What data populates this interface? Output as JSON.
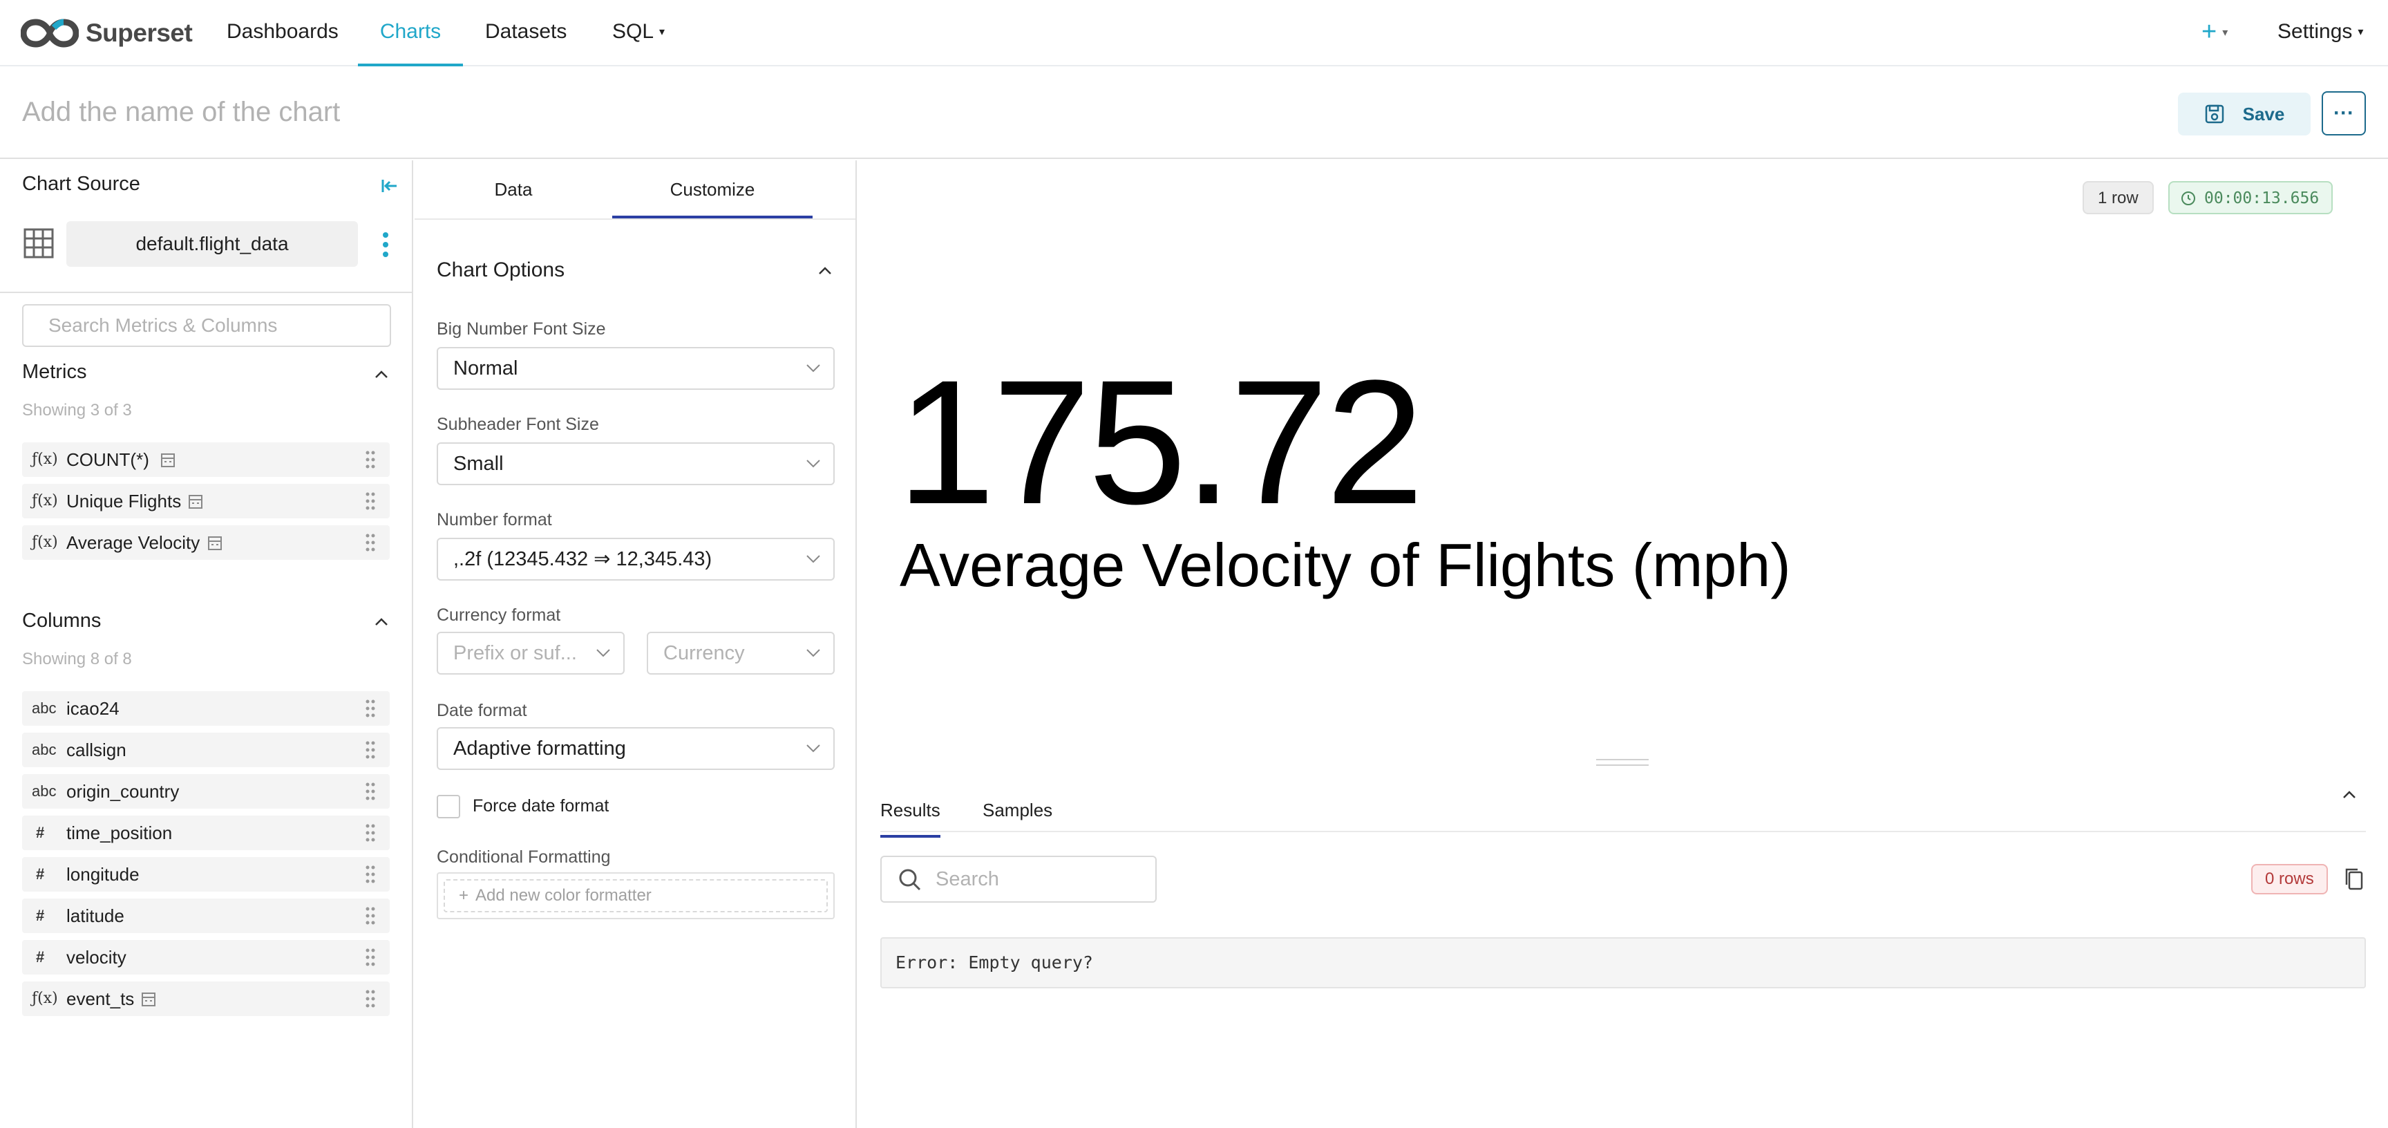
{
  "app": {
    "brand": "Superset"
  },
  "nav": {
    "items": [
      {
        "label": "Dashboards"
      },
      {
        "label": "Charts"
      },
      {
        "label": "Datasets"
      },
      {
        "label": "SQL"
      }
    ],
    "settings_label": "Settings",
    "accent_color": "#20a7c9"
  },
  "header": {
    "title_placeholder": "Add the name of the chart",
    "save_label": "Save"
  },
  "source": {
    "title": "Chart Source",
    "dataset": "default.flight_data",
    "search_placeholder": "Search Metrics & Columns"
  },
  "metrics": {
    "title": "Metrics",
    "showing": "Showing 3 of 3",
    "items": [
      {
        "type": "ƒ(x)",
        "label": "COUNT(*)"
      },
      {
        "type": "ƒ(x)",
        "label": "Unique Flights"
      },
      {
        "type": "ƒ(x)",
        "label": "Average Velocity"
      }
    ]
  },
  "columns": {
    "title": "Columns",
    "showing": "Showing 8 of 8",
    "items": [
      {
        "type": "abc",
        "label": "icao24"
      },
      {
        "type": "abc",
        "label": "callsign"
      },
      {
        "type": "abc",
        "label": "origin_country"
      },
      {
        "type": "#",
        "label": "time_position"
      },
      {
        "type": "#",
        "label": "longitude"
      },
      {
        "type": "#",
        "label": "latitude"
      },
      {
        "type": "#",
        "label": "velocity"
      },
      {
        "type": "ƒ(x)",
        "label": "event_ts"
      }
    ]
  },
  "controls": {
    "tabs": [
      "Data",
      "Customize"
    ],
    "section_title": "Chart Options",
    "big_number_font_size": {
      "label": "Big Number Font Size",
      "value": "Normal"
    },
    "subheader_font_size": {
      "label": "Subheader Font Size",
      "value": "Small"
    },
    "number_format": {
      "label": "Number format",
      "value": ",.2f (12345.432 ⇒ 12,345.43)"
    },
    "currency_format": {
      "label": "Currency format",
      "prefix_placeholder": "Prefix or suf...",
      "currency_placeholder": "Currency"
    },
    "date_format": {
      "label": "Date format",
      "value": "Adaptive formatting"
    },
    "force_date_format": {
      "label": "Force date format",
      "checked": false
    },
    "conditional_formatting": {
      "label": "Conditional Formatting",
      "add_label": "Add new color formatter"
    }
  },
  "chart": {
    "row_count": "1 row",
    "timer": "00:00:13.656",
    "big_number": "175.72",
    "subheader": "Average Velocity of Flights (mph)"
  },
  "results": {
    "tabs": [
      "Results",
      "Samples"
    ],
    "search_placeholder": "Search",
    "rows_badge": "0 rows",
    "error": "Error: Empty query?"
  }
}
